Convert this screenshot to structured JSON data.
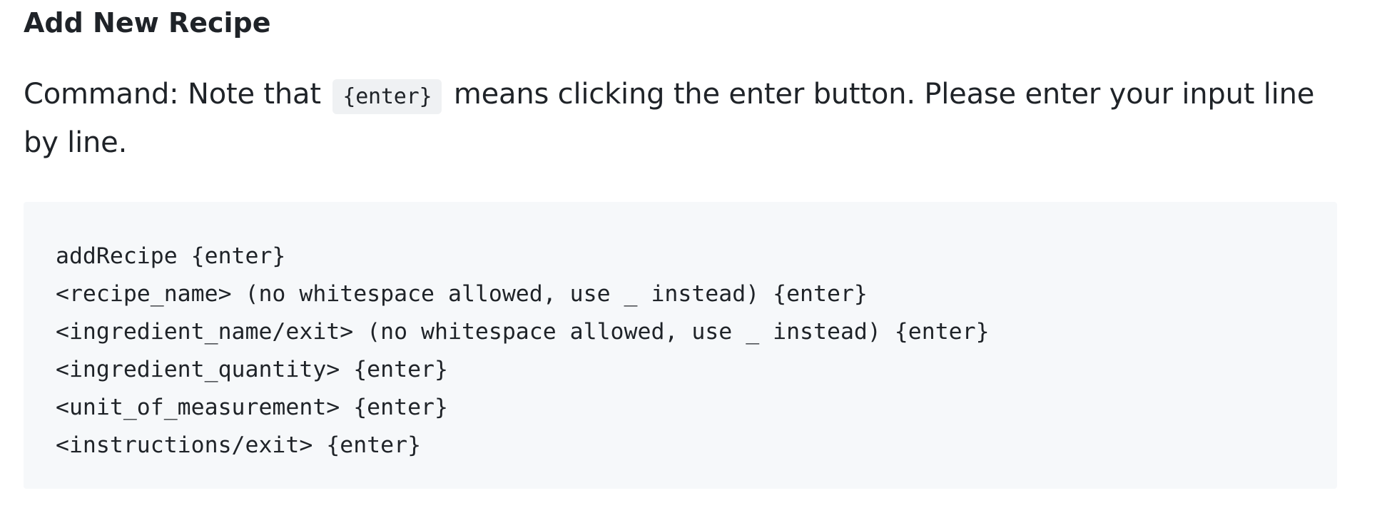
{
  "heading": "Add New Recipe",
  "paragraph": {
    "before_code": "Command: Note that",
    "inline_code": "{enter}",
    "after_code": "means clicking the enter button. Please enter your input line by line."
  },
  "code_block": {
    "lines": [
      "addRecipe {enter}",
      "<recipe_name> (no whitespace allowed, use _ instead) {enter}",
      "<ingredient_name/exit> (no whitespace allowed, use _ instead) {enter}",
      "<ingredient_quantity> {enter}",
      "<unit_of_measurement> {enter}",
      "<instructions/exit> {enter}"
    ]
  }
}
